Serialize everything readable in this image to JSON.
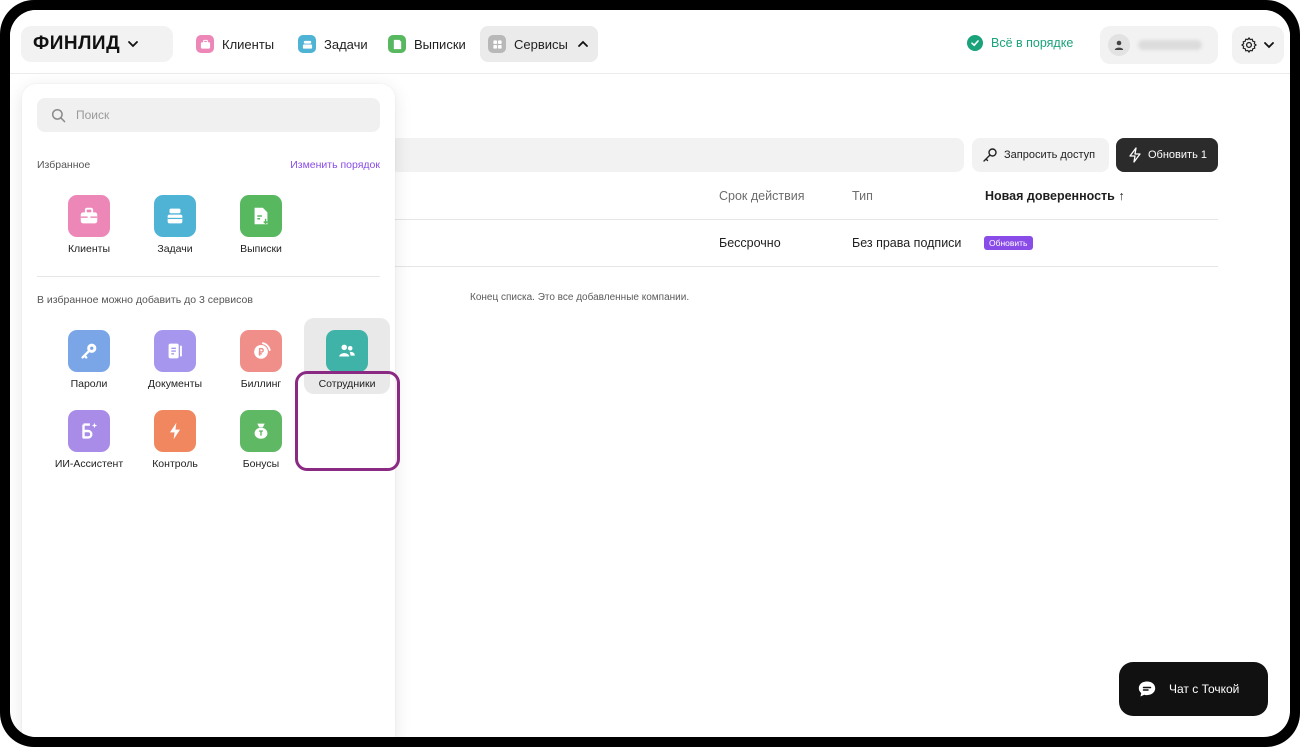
{
  "header": {
    "logo": "ФИНЛИД",
    "nav": [
      {
        "label": "Клиенты",
        "icon": "briefcase-icon",
        "color": "#ec87b7"
      },
      {
        "label": "Задачи",
        "icon": "stack-icon",
        "color": "#4fb3d6"
      },
      {
        "label": "Выписки",
        "icon": "document-icon",
        "color": "#58b85f"
      },
      {
        "label": "Сервисы",
        "icon": "grid-icon",
        "color": "#b8b8b8"
      }
    ],
    "status": "Всё в порядке"
  },
  "main": {
    "request_access": "Запросить доступ",
    "update_button": "Обновить 1",
    "columns": [
      "Срок действия",
      "Тип",
      "Новая доверенность ↑"
    ],
    "row": {
      "term": "Бессрочно",
      "type": "Без права подписи",
      "badge": "Обновить"
    },
    "end_of_list": "Конец списка. Это все добавленные компании."
  },
  "panel": {
    "search_placeholder": "Поиск",
    "favorites_label": "Избранное",
    "edit_order": "Изменить порядок",
    "favorites": [
      {
        "label": "Клиенты",
        "icon": "briefcase-icon",
        "color": "#ec87b7"
      },
      {
        "label": "Задачи",
        "icon": "stack-icon",
        "color": "#4fb3d6"
      },
      {
        "label": "Выписки",
        "icon": "document-icon",
        "color": "#58b85f"
      }
    ],
    "add_hint": "В избранное можно добавить до 3 сервисов",
    "services": [
      {
        "label": "Пароли",
        "icon": "key-icon",
        "color": "#7aa6e8"
      },
      {
        "label": "Документы",
        "icon": "docs-icon",
        "color": "#a796ee"
      },
      {
        "label": "Биллинг",
        "icon": "ruble-icon",
        "color": "#f08f8a"
      },
      {
        "label": "Сотрудники",
        "icon": "people-icon",
        "color": "#3fb3a8"
      },
      {
        "label": "ИИ-Ассистент",
        "icon": "ai-icon",
        "color": "#a98ce8"
      },
      {
        "label": "Контроль",
        "icon": "lightning-icon",
        "color": "#f0875f"
      },
      {
        "label": "Бонусы",
        "icon": "moneybag-icon",
        "color": "#5fb863"
      }
    ]
  },
  "chat": {
    "label": "Чат с Точкой"
  }
}
